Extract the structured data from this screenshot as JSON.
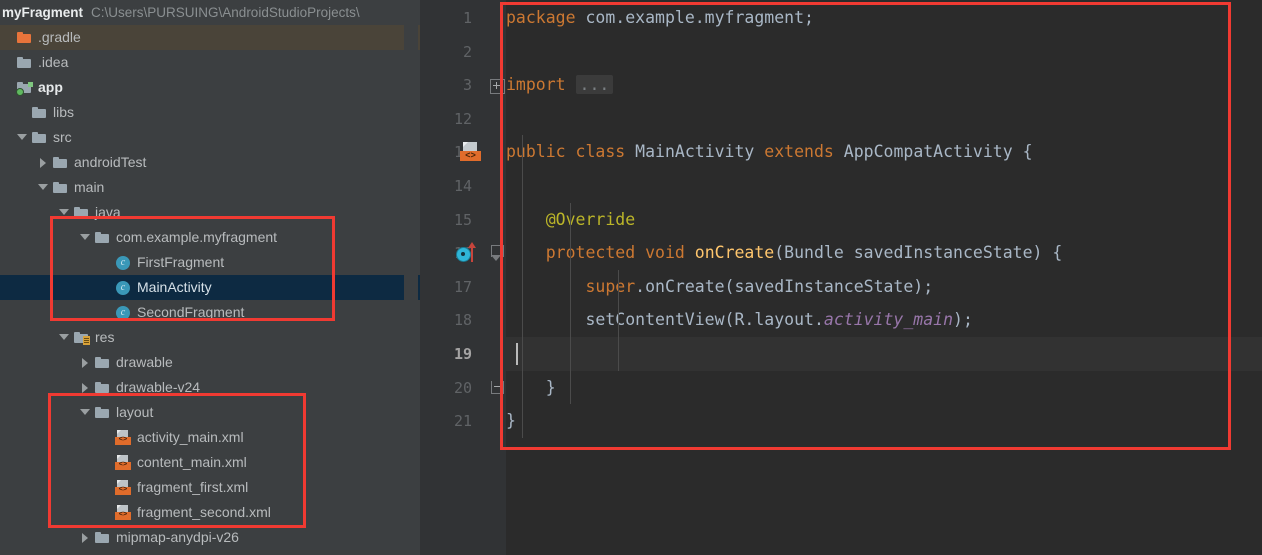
{
  "window": {
    "project_name": "myFragment",
    "project_path": "C:\\Users\\PURSUING\\AndroidStudioProjects\\"
  },
  "sidebar": {
    "items": [
      {
        "label": ".gradle",
        "icon": "folder-orange-icon",
        "indent": 0,
        "arrow": "none",
        "state": "hover"
      },
      {
        "label": ".idea",
        "icon": "folder-icon",
        "indent": 0,
        "arrow": "none",
        "state": "normal"
      },
      {
        "label": "app",
        "icon": "module-folder-icon",
        "indent": 0,
        "arrow": "none",
        "state": "bold"
      },
      {
        "label": "libs",
        "icon": "folder-icon",
        "indent": 1,
        "arrow": "none",
        "state": "normal"
      },
      {
        "label": "src",
        "icon": "folder-icon",
        "indent": 1,
        "arrow": "down",
        "state": "normal"
      },
      {
        "label": "androidTest",
        "icon": "folder-icon",
        "indent": 2,
        "arrow": "right",
        "state": "normal"
      },
      {
        "label": "main",
        "icon": "folder-icon",
        "indent": 2,
        "arrow": "down",
        "state": "normal"
      },
      {
        "label": "java",
        "icon": "folder-icon",
        "indent": 3,
        "arrow": "down",
        "state": "normal"
      },
      {
        "label": "com.example.myfragment",
        "icon": "package-folder-icon",
        "indent": 4,
        "arrow": "down",
        "state": "normal"
      },
      {
        "label": "FirstFragment",
        "icon": "java-class-icon",
        "indent": 5,
        "arrow": "none",
        "state": "normal"
      },
      {
        "label": "MainActivity",
        "icon": "java-class-icon",
        "indent": 5,
        "arrow": "none",
        "state": "selected"
      },
      {
        "label": "SecondFragment",
        "icon": "java-class-icon",
        "indent": 5,
        "arrow": "none",
        "state": "normal"
      },
      {
        "label": "res",
        "icon": "res-folder-icon",
        "indent": 3,
        "arrow": "down",
        "state": "normal"
      },
      {
        "label": "drawable",
        "icon": "folder-icon",
        "indent": 4,
        "arrow": "right",
        "state": "normal"
      },
      {
        "label": "drawable-v24",
        "icon": "folder-icon",
        "indent": 4,
        "arrow": "right",
        "state": "normal"
      },
      {
        "label": "layout",
        "icon": "folder-icon",
        "indent": 4,
        "arrow": "down",
        "state": "normal"
      },
      {
        "label": "activity_main.xml",
        "icon": "layout-xml-icon",
        "indent": 5,
        "arrow": "none",
        "state": "normal"
      },
      {
        "label": "content_main.xml",
        "icon": "layout-xml-icon",
        "indent": 5,
        "arrow": "none",
        "state": "normal"
      },
      {
        "label": "fragment_first.xml",
        "icon": "layout-xml-icon",
        "indent": 5,
        "arrow": "none",
        "state": "normal"
      },
      {
        "label": "fragment_second.xml",
        "icon": "layout-xml-icon",
        "indent": 5,
        "arrow": "none",
        "state": "normal"
      },
      {
        "label": "mipmap-anydpi-v26",
        "icon": "folder-icon",
        "indent": 4,
        "arrow": "right",
        "state": "normal"
      }
    ]
  },
  "editor": {
    "line_numbers": [
      "1",
      "2",
      "3",
      "12",
      "13",
      "14",
      "15",
      "16",
      "17",
      "18",
      "19",
      "20",
      "21"
    ],
    "current_line": "19",
    "lines": [
      {
        "num": "1",
        "tokens": [
          {
            "t": "package",
            "c": "kw"
          },
          {
            "t": " com.example.myfragment;",
            "c": "pl"
          }
        ]
      },
      {
        "num": "2",
        "tokens": []
      },
      {
        "num": "3",
        "tokens": [
          {
            "t": "import",
            "c": "kw"
          },
          {
            "t": " ",
            "c": "pl"
          },
          {
            "t": "...",
            "c": "fold"
          }
        ]
      },
      {
        "num": "12",
        "tokens": []
      },
      {
        "num": "13",
        "tokens": [
          {
            "t": "public class",
            "c": "kw"
          },
          {
            "t": " MainActivity ",
            "c": "pl"
          },
          {
            "t": "extends",
            "c": "kw"
          },
          {
            "t": " AppCompatActivity {",
            "c": "pl"
          }
        ]
      },
      {
        "num": "14",
        "tokens": []
      },
      {
        "num": "15",
        "tokens": [
          {
            "t": "    @Override",
            "c": "an"
          }
        ]
      },
      {
        "num": "16",
        "tokens": [
          {
            "t": "    ",
            "c": "pl"
          },
          {
            "t": "protected void",
            "c": "kw"
          },
          {
            "t": " ",
            "c": "pl"
          },
          {
            "t": "onCreate",
            "c": "fn"
          },
          {
            "t": "(Bundle savedInstanceState) {",
            "c": "pl"
          }
        ]
      },
      {
        "num": "17",
        "tokens": [
          {
            "t": "        ",
            "c": "pl"
          },
          {
            "t": "super",
            "c": "kw"
          },
          {
            "t": ".onCreate(savedInstanceState);",
            "c": "pl"
          }
        ]
      },
      {
        "num": "18",
        "tokens": [
          {
            "t": "        setContentView(R.layout.",
            "c": "pl"
          },
          {
            "t": "activity_main",
            "c": "fld"
          },
          {
            "t": ");",
            "c": "pl"
          }
        ]
      },
      {
        "num": "19",
        "tokens": []
      },
      {
        "num": "20",
        "tokens": [
          {
            "t": "    }",
            "c": "pl"
          }
        ]
      },
      {
        "num": "21",
        "tokens": [
          {
            "t": "}",
            "c": "pl"
          }
        ]
      }
    ],
    "gutter_markers": [
      {
        "line": "3",
        "icon": "fold-expand-icon"
      },
      {
        "line": "13",
        "icon": "layout-xml-icon"
      },
      {
        "line": "16",
        "icon": "override-method-icon"
      },
      {
        "line": "16",
        "icon": "fold-collapse-icon"
      },
      {
        "line": "20",
        "icon": "fold-end-icon"
      }
    ]
  },
  "annotations": {
    "color": "#f03a32",
    "boxes": [
      {
        "name": "package-classes-highlight"
      },
      {
        "name": "layout-folder-highlight"
      },
      {
        "name": "editor-code-highlight"
      }
    ]
  }
}
